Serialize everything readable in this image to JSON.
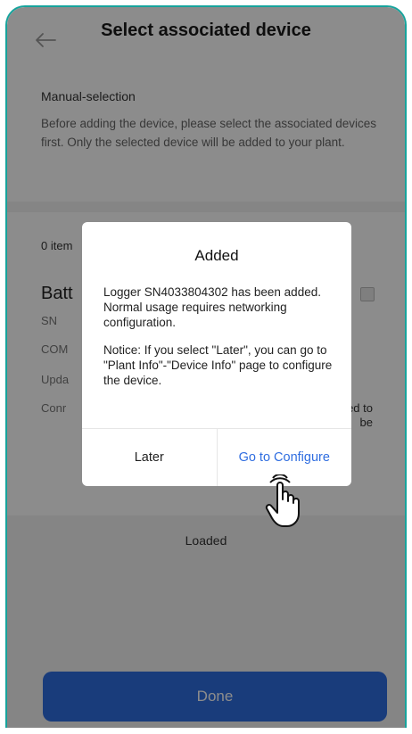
{
  "header": {
    "title": "Select associated device",
    "back_icon": "arrow-left-icon"
  },
  "intro": {
    "heading": "Manual-selection",
    "text": "Before adding the device, please select the associated devices first. Only the selected device will be added to your plant."
  },
  "list": {
    "count_label": "0 item",
    "device": {
      "name": "Batt",
      "fields": [
        "SN",
        "COM",
        "Upda",
        "Conr"
      ],
      "side_note_line1": "ed to",
      "side_note_line2": "be"
    },
    "loaded_label": "Loaded"
  },
  "footer": {
    "done_label": "Done"
  },
  "dialog": {
    "title": "Added",
    "message": "Logger SN4033804302 has been added. Normal usage requires networking configuration.",
    "notice": "Notice: If you select \"Later\", you can go to \"Plant Info\"-\"Device Info\" page to configure the device.",
    "later_label": "Later",
    "configure_label": "Go to Configure"
  },
  "pointer_icon": "hand-pointer-icon",
  "colors": {
    "accent": "#2f6de0",
    "frame": "#16a39c"
  }
}
